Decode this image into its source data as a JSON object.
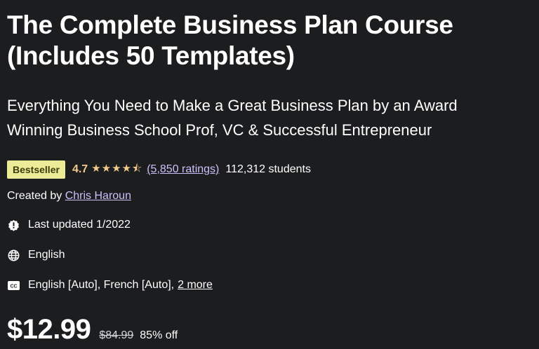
{
  "course": {
    "title_line1": "The Complete Business Plan Course",
    "title_line2": "(Includes 50 Templates)",
    "subtitle_line1": "Everything You Need to Make a Great Business Plan by an Award",
    "subtitle_line2": "Winning Business School Prof, VC & Successful Entrepreneur",
    "badge": "Bestseller",
    "rating": "4.7",
    "stars": "★★★★★",
    "rating_value": 4.7,
    "ratings_count": "(5,850 ratings)",
    "students": "112,312 students",
    "created_prefix": "Created by",
    "author": "Chris Haroun",
    "last_updated": "Last updated 1/2022",
    "language": "English",
    "captions": "English [Auto], French [Auto],",
    "captions_more": "2 more",
    "price": "$12.99",
    "original_price": "$84.99",
    "discount": "85% off"
  },
  "colors": {
    "background": "#1c1d1f",
    "badge": "#eceb98",
    "rating": "#f3ca8c",
    "link": "#cec0fc"
  },
  "icons": [
    "alert-badge-icon",
    "globe-icon",
    "closed-captions-icon",
    "star-icon"
  ]
}
